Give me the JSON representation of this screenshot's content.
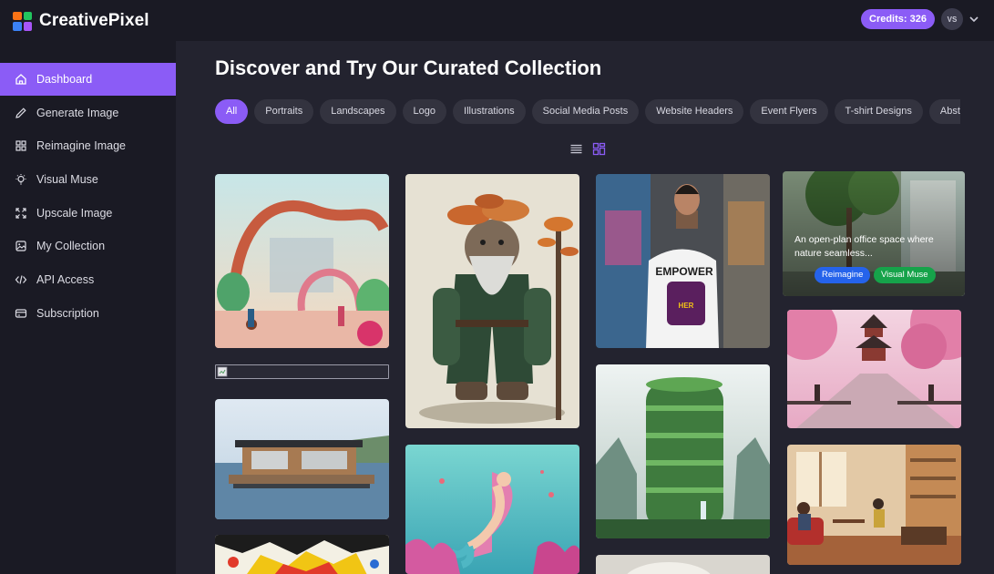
{
  "app": {
    "name": "CreativePixel",
    "credits_label": "Credits: 326",
    "user_initials": "VS"
  },
  "sidebar": {
    "items": [
      {
        "label": "Dashboard",
        "icon": "home-icon",
        "active": true
      },
      {
        "label": "Generate Image",
        "icon": "pencil-icon"
      },
      {
        "label": "Reimagine Image",
        "icon": "grid-icon"
      },
      {
        "label": "Visual Muse",
        "icon": "lightbulb-icon"
      },
      {
        "label": "Upscale Image",
        "icon": "expand-icon"
      },
      {
        "label": "My Collection",
        "icon": "image-icon"
      },
      {
        "label": "API Access",
        "icon": "code-icon"
      },
      {
        "label": "Subscription",
        "icon": "card-icon"
      }
    ]
  },
  "main": {
    "title": "Discover and Try Our Curated Collection",
    "filters": [
      "All",
      "Portraits",
      "Landscapes",
      "Logo",
      "Illustrations",
      "Social Media Posts",
      "Website Headers",
      "Event Flyers",
      "T-shirt Designs",
      "Abstract"
    ],
    "active_filter": "All",
    "view_modes": [
      "list-view-icon",
      "grid-view-icon"
    ],
    "active_view": "grid-view-icon",
    "hover_card": {
      "description": "An open-plan office space where nature seamless...",
      "reimagine_label": "Reimagine",
      "visual_muse_label": "Visual Muse"
    },
    "shirt_text": "EMPOWER",
    "shirt_subtext": "HER"
  },
  "colors": {
    "accent": "#8b5cf6",
    "reimagine": "#2563eb",
    "visual_muse": "#16a34a",
    "sidebar_bg": "#1a1a24",
    "main_bg": "#23232f"
  }
}
